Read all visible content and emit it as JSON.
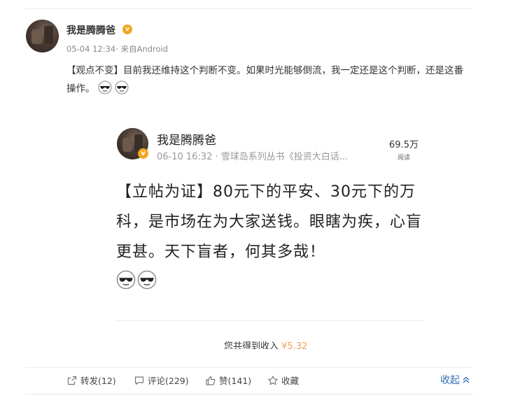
{
  "post": {
    "author_name": "我是腾腾爸",
    "badge": "v",
    "meta": "05-04 12:34· 来自Android",
    "text": "【观点不变】目前我还维持这个判断不变。如果时光能够倒流，我一定还是这个判断，还是这番操作。",
    "emoji_icons": [
      "sunglasses-emoji-icon",
      "sunglasses-emoji-icon"
    ]
  },
  "quoted": {
    "author_name": "我是腾腾爸",
    "badge": "v",
    "meta": "06-10 16:32 · 雪球岛系列丛书《投资大白话...",
    "views_count": "69.5万",
    "views_label": "阅读",
    "text": "【立帖为证】80元下的平安、30元下的万科，是市场在为大家送钱。眼瞎为疾，心盲更甚。天下盲者，何其多哉！",
    "emoji_icons": [
      "sunglasses-emoji-icon",
      "sunglasses-emoji-icon"
    ],
    "income_label": "您共得到收入",
    "income_amount": "¥5.32"
  },
  "actions": {
    "repost": "转发(12)",
    "comment": "评论(229)",
    "like": "赞(141)",
    "favorite": "收藏",
    "collapse": "收起"
  },
  "colors": {
    "link": "#2f6fb5",
    "badge": "#f4a623",
    "income": "#f0a05a"
  }
}
